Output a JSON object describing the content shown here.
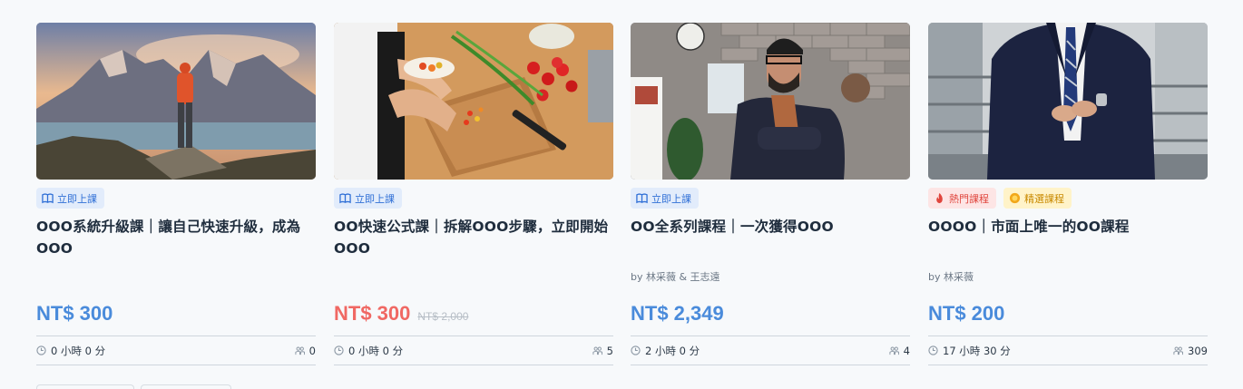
{
  "courses": [
    {
      "image": "mountain-hiker-photo",
      "tags": [
        {
          "label": "立即上課",
          "icon": "book-icon",
          "color": "#2f6fd6"
        }
      ],
      "title": "OOO系統升級課｜讓自己快速升級，成為OOO",
      "author": "",
      "price": "NT$ 300",
      "original_price": "",
      "duration": "0 小時 0 分",
      "students": "0"
    },
    {
      "image": "cooking-cutting-board-photo",
      "tags": [
        {
          "label": "立即上課",
          "icon": "book-icon",
          "color": "#2f6fd6"
        }
      ],
      "title": "OO快速公式課｜拆解OOO步驟，立即開始OOO",
      "author": "",
      "price": "NT$ 300",
      "original_price": "NT$ 2,000",
      "duration": "0 小時 0 分",
      "students": "5"
    },
    {
      "image": "man-crossed-arms-photo",
      "tags": [
        {
          "label": "立即上課",
          "icon": "book-icon",
          "color": "#2f6fd6"
        }
      ],
      "title": "OO全系列課程｜一次獲得OOO",
      "author": "by 林采薇 & 王志遠",
      "price": "NT$ 2,349",
      "original_price": "",
      "duration": "2 小時 0 分",
      "students": "4"
    },
    {
      "image": "businessman-suit-photo",
      "tags": [
        {
          "label": "熱門課程",
          "icon": "fire-icon",
          "color": "#e0453d"
        },
        {
          "label": "精選課程",
          "icon": "star-badge-icon",
          "color": "#c98a00"
        }
      ],
      "title": "OOOO｜市面上唯一的OO課程",
      "author": "by 林采薇",
      "price": "NT$ 200",
      "original_price": "",
      "duration": "17 小時 30 分",
      "students": "309"
    }
  ],
  "colors": {
    "price": "#4a8bdb",
    "sale_price": "#f06863",
    "accent_blue": "#2f6fd6"
  }
}
